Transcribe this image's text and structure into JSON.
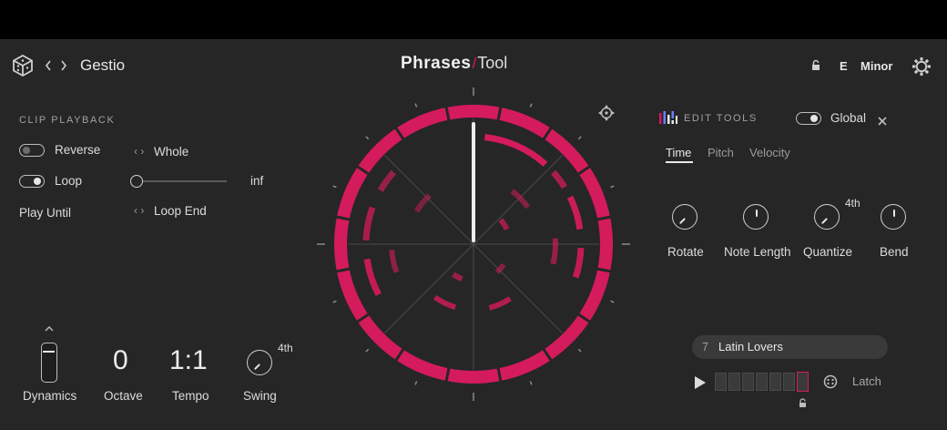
{
  "header": {
    "project_name": "Gestio",
    "logo_text_main": "Phrases",
    "logo_text_sub": "Tool",
    "key": "E",
    "scale": "Minor"
  },
  "clip_playback": {
    "section_label": "CLIP PLAYBACK",
    "reverse_label": "Reverse",
    "reverse_on": false,
    "reverse_mode": "Whole",
    "loop_label": "Loop",
    "loop_on": true,
    "loop_value": "inf",
    "play_until_label": "Play Until",
    "play_until_value": "Loop End"
  },
  "bottom_controls": {
    "dynamics_label": "Dynamics",
    "octave_value": "0",
    "octave_label": "Octave",
    "tempo_value": "1:1",
    "tempo_label": "Tempo",
    "swing_label": "Swing",
    "swing_value": "4th"
  },
  "edit_tools": {
    "section_label": "EDIT TOOLS",
    "global_label": "Global",
    "global_on": true,
    "tabs": [
      {
        "label": "Time",
        "active": true
      },
      {
        "label": "Pitch",
        "active": false
      },
      {
        "label": "Velocity",
        "active": false
      }
    ],
    "knobs": [
      {
        "label": "Rotate",
        "value": ""
      },
      {
        "label": "Note Length",
        "value": ""
      },
      {
        "label": "Quantize",
        "value": "4th"
      },
      {
        "label": "Bend",
        "value": ""
      }
    ]
  },
  "preset": {
    "number": "7",
    "name": "Latin Lovers"
  },
  "transport": {
    "latch_label": "Latch",
    "step_count": 7,
    "active_step": 7
  },
  "colors": {
    "accent": "#d41b5c",
    "background": "#262626",
    "panel": "#3a3a3a"
  },
  "icons": [
    "cube-icon",
    "back-icon",
    "forward-icon",
    "lock-icon",
    "gear-icon",
    "move-icon",
    "edit-tools-icon",
    "close-icon",
    "play-icon",
    "dice-icon",
    "small-lock-icon",
    "chevron-up-icon"
  ]
}
